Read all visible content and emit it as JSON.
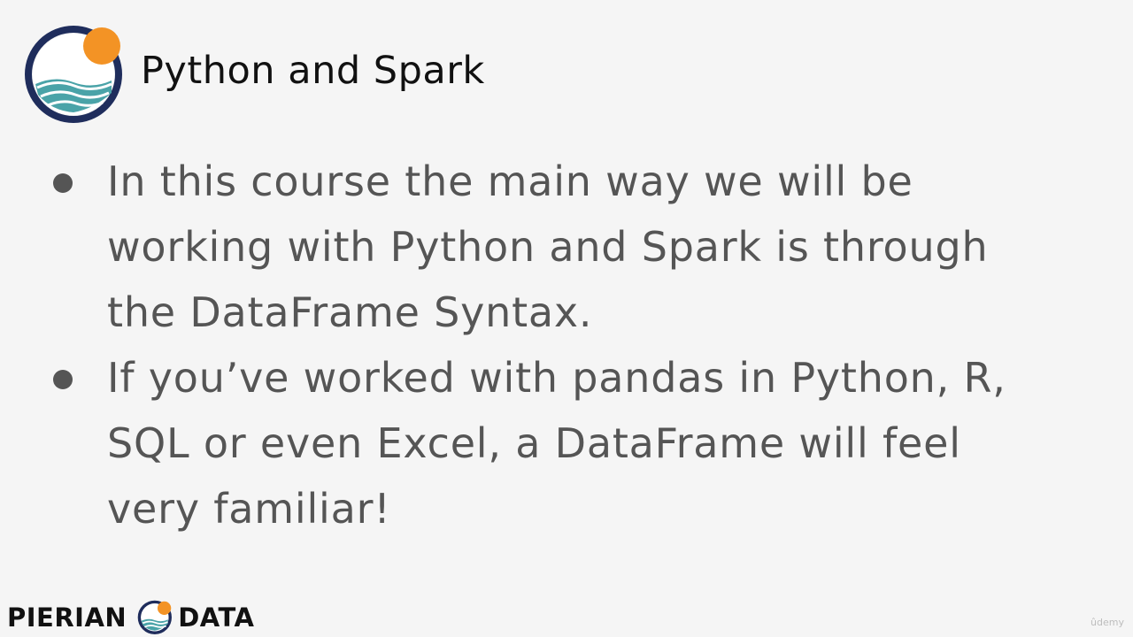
{
  "slide": {
    "title": "Python and Spark",
    "bullets": [
      {
        "text": "In this course the main way we will be working with Python and Spark is through the DataFrame Syntax."
      },
      {
        "text": "If you’ve worked with pandas in Python, R, SQL or even Excel, a DataFrame will feel very familiar!"
      }
    ]
  },
  "footer": {
    "brand_left": "PIERIAN",
    "brand_right": "DATA",
    "watermark": "ûdemy"
  },
  "logo": {
    "ring_color": "#1f2d5c",
    "sun_color": "#f39325",
    "wave_color": "#4aa3a8"
  }
}
